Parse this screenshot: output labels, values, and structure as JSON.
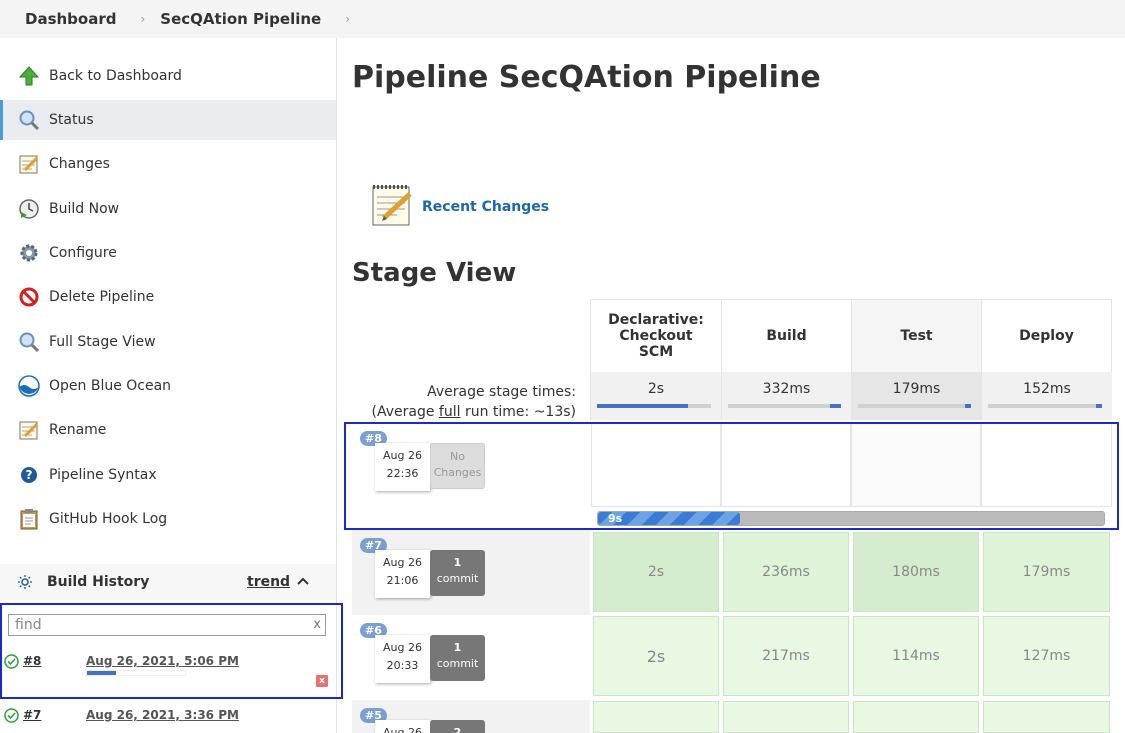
{
  "breadcrumb": {
    "root": "Dashboard",
    "job": "SecQAtion Pipeline"
  },
  "sidebar": {
    "items": [
      {
        "label": "Back to Dashboard",
        "icon": "up-arrow-icon"
      },
      {
        "label": "Status",
        "icon": "search-icon"
      },
      {
        "label": "Changes",
        "icon": "notepad-icon"
      },
      {
        "label": "Build Now",
        "icon": "clock-play-icon"
      },
      {
        "label": "Configure",
        "icon": "gear-icon"
      },
      {
        "label": "Delete Pipeline",
        "icon": "no-entry-icon"
      },
      {
        "label": "Full Stage View",
        "icon": "search-icon"
      },
      {
        "label": "Open Blue Ocean",
        "icon": "blue-ocean-icon"
      },
      {
        "label": "Rename",
        "icon": "notepad-icon"
      },
      {
        "label": "Pipeline Syntax",
        "icon": "help-icon"
      },
      {
        "label": "GitHub Hook Log",
        "icon": "clipboard-icon"
      }
    ]
  },
  "build_history": {
    "title": "Build History",
    "trend": "trend",
    "find_placeholder": "find",
    "clear": "x",
    "builds": [
      {
        "num": "#8",
        "date": "Aug 26, 2021, 5:06 PM",
        "in_progress": true,
        "progress": 0.3
      },
      {
        "num": "#7",
        "date": "Aug 26, 2021, 3:36 PM"
      }
    ]
  },
  "main": {
    "title": "Pipeline SecQAtion Pipeline",
    "recent_changes": "Recent Changes",
    "stage_view_title": "Stage View",
    "avg_label_1": "Average stage times:",
    "avg_label_2a": "(Average ",
    "avg_label_2b": "full",
    "avg_label_2c": " run time: ~13s)",
    "stages": [
      {
        "name": "Declarative: Checkout SCM",
        "avg": "2s",
        "avg_fill": 0.8
      },
      {
        "name": "Build",
        "avg": "332ms",
        "avg_fill": 0.1
      },
      {
        "name": "Test",
        "avg": "179ms",
        "avg_fill": 0.05
      },
      {
        "name": "Deploy",
        "avg": "152ms",
        "avg_fill": 0.05
      }
    ],
    "runs": [
      {
        "badge": "#8",
        "date": "Aug 26",
        "time": "22:36",
        "changes": "No Changes",
        "running": "9s",
        "run_progress": 0.28,
        "times": [
          "",
          "",
          "",
          ""
        ]
      },
      {
        "badge": "#7",
        "date": "Aug 26",
        "time": "21:06",
        "changes_count": "1",
        "changes_unit": "commit",
        "times": [
          "2s",
          "236ms",
          "180ms",
          "179ms"
        ]
      },
      {
        "badge": "#6",
        "date": "Aug 26",
        "time": "20:33",
        "changes_count": "1",
        "changes_unit": "commit",
        "times": [
          "2s",
          "217ms",
          "114ms",
          "127ms"
        ]
      },
      {
        "badge": "#5",
        "date": "Aug 26",
        "time": "",
        "changes_count": "2",
        "changes_unit": "",
        "times": [
          "",
          "",
          "",
          ""
        ]
      }
    ]
  },
  "colors": {
    "accent": "#4472c4",
    "success_cell": "#dff3d9",
    "highlight": "#1a2bc8"
  }
}
